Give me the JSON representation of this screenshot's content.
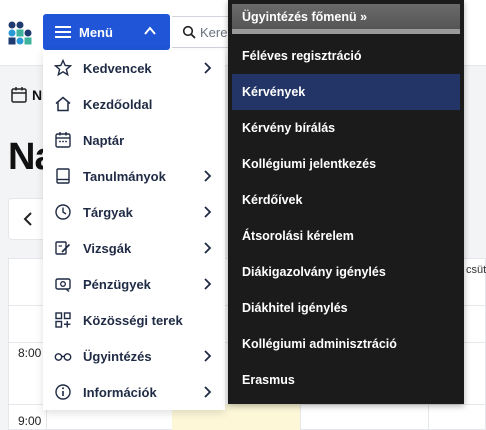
{
  "header": {
    "menu_label": "Menü",
    "search_placeholder": "Keres"
  },
  "page": {
    "date_label": "N",
    "heading": "Na",
    "times": [
      "8:00",
      "9:00"
    ],
    "day_col_label": "csüt"
  },
  "menu": {
    "items": [
      {
        "label": "Kedvencek",
        "icon": "star-icon",
        "has_submenu": true
      },
      {
        "label": "Kezdőoldal",
        "icon": "home-icon",
        "has_submenu": false
      },
      {
        "label": "Naptár",
        "icon": "calendar-icon",
        "has_submenu": false
      },
      {
        "label": "Tanulmányok",
        "icon": "book-icon",
        "has_submenu": true
      },
      {
        "label": "Tárgyak",
        "icon": "clock-icon",
        "has_submenu": true
      },
      {
        "label": "Vizsgák",
        "icon": "pencil-note-icon",
        "has_submenu": true
      },
      {
        "label": "Pénzügyek",
        "icon": "money-icon",
        "has_submenu": true
      },
      {
        "label": "Közösségi terek",
        "icon": "grid-plus-icon",
        "has_submenu": false
      },
      {
        "label": "Ügyintézés",
        "icon": "glasses-icon",
        "has_submenu": true
      },
      {
        "label": "Információk",
        "icon": "info-icon",
        "has_submenu": true
      }
    ]
  },
  "submenu": {
    "header": "Ügyintézés főmenü »",
    "items": [
      "Féléves regisztráció",
      "Kérvények",
      "Kérvény bírálás",
      "Kollégiumi jelentkezés",
      "Kérdőívek",
      "Átsorolási kérelem",
      "Diákigazolvány igénylés",
      "Diákhitel igénylés",
      "Kollégiumi adminisztráció",
      "Erasmus"
    ],
    "active_index": 1
  },
  "colors": {
    "menu_button": "#1f55d6",
    "submenu_bg": "#1b1b1b",
    "submenu_active": "#223566"
  }
}
